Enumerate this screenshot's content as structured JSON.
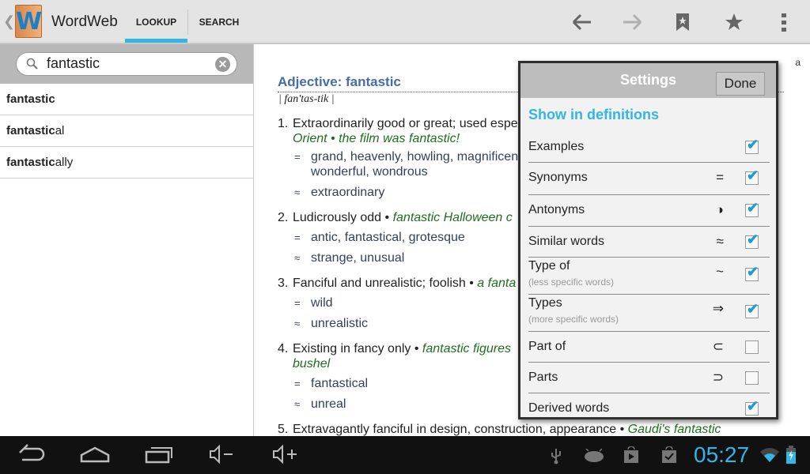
{
  "app": {
    "title": "WordWeb",
    "logo_letter": "W"
  },
  "tabs": [
    {
      "label": "LOOKUP",
      "active": true
    },
    {
      "label": "SEARCH",
      "active": false
    }
  ],
  "toolbar": {
    "icons": [
      "back-arrow-icon",
      "forward-arrow-icon",
      "add-bookmark-icon",
      "star-icon",
      "overflow-menu-icon"
    ]
  },
  "search": {
    "value": "fantastic",
    "placeholder": ""
  },
  "results": [
    {
      "match": "fantastic",
      "rest": ""
    },
    {
      "match": "fantastic",
      "rest": "al"
    },
    {
      "match": "fantastic",
      "rest": "ally"
    }
  ],
  "definition": {
    "heading": "Adjective: fantastic",
    "pronunciation": "| fan'tas-tik |",
    "edge_letter": "a",
    "senses": [
      {
        "num": "1.",
        "text": "Extraordinarily good or great; used espe",
        "example": "",
        "cont_example": "Orient • the film was fantastic!",
        "syn": "grand, heavenly, howling, magnificen",
        "syn2": "wonderful, wondrous",
        "sim": "extraordinary"
      },
      {
        "num": "2.",
        "text": "Ludicrously odd •",
        "example": "fantastic Halloween c",
        "syn": "antic, fantastical, grotesque",
        "sim": "strange, unusual"
      },
      {
        "num": "3.",
        "text": "Fanciful and unrealistic; foolish •",
        "example": "a fanta",
        "syn": "wild",
        "sim": "unrealistic"
      },
      {
        "num": "4.",
        "text": "Existing in fancy only •",
        "example": "fantastic figures",
        "cont_example": "bushel",
        "syn": "fantastical",
        "sim": "unreal"
      },
      {
        "num": "5.",
        "text": "Extravagantly fanciful in design, construction, appearance •",
        "example": "Gaudi's fantastic"
      }
    ],
    "syn_symbol": "=",
    "sim_symbol": "≈"
  },
  "settings": {
    "title": "Settings",
    "done_label": "Done",
    "section": "Show in definitions",
    "accent": "#33b5e5",
    "options": [
      {
        "label": "Examples",
        "symbol": "",
        "checked": true
      },
      {
        "label": "Synonyms",
        "symbol": "=",
        "checked": true
      },
      {
        "label": "Antonyms",
        "symbol": "◑",
        "checked": true
      },
      {
        "label": "Similar words",
        "symbol": "≈",
        "checked": true
      },
      {
        "label": "Type of",
        "sub": "(less specific words)",
        "symbol": "~",
        "checked": true
      },
      {
        "label": "Types",
        "sub": "(more specific words)",
        "symbol": "⇒",
        "checked": true
      },
      {
        "label": "Part of",
        "symbol": "⊂",
        "checked": false
      },
      {
        "label": "Parts",
        "symbol": "⊃",
        "checked": false
      },
      {
        "label": "Derived words",
        "symbol": "",
        "checked": true
      }
    ]
  },
  "statusbar": {
    "time": "05:27",
    "icons": [
      "usb-icon",
      "android-debug-icon",
      "play-store-icon",
      "store-update-icon",
      "wifi-icon",
      "battery-charging-icon"
    ]
  },
  "navbar": {
    "icons": [
      "back-icon",
      "home-icon",
      "recent-apps-icon",
      "volume-down-icon",
      "volume-up-icon"
    ]
  }
}
